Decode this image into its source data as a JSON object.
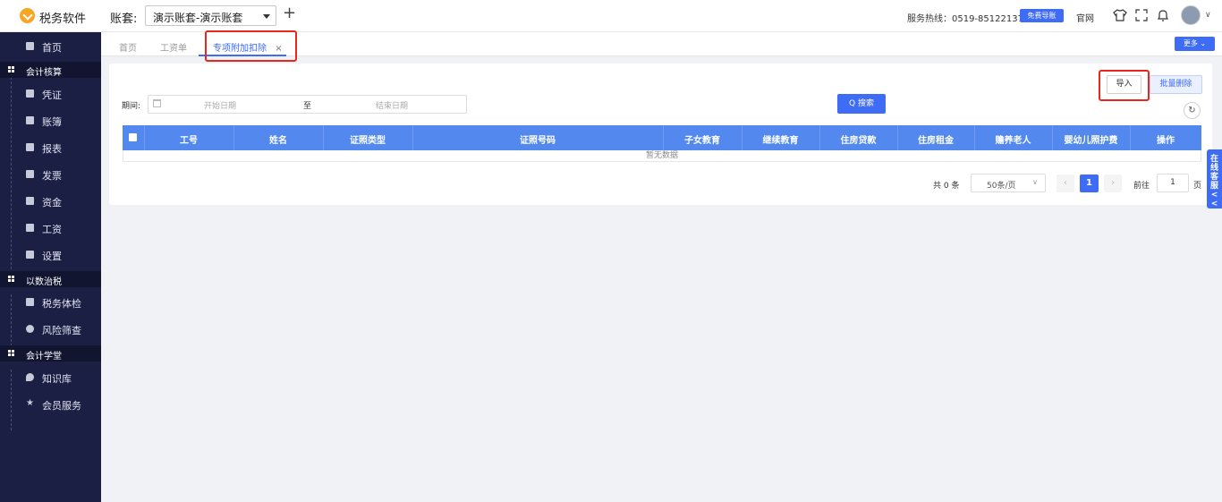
{
  "header": {
    "app_name": "税务软件",
    "account_label": "账套:",
    "account_value": "演示账套-演示账套",
    "hotline": "服务热线：0519-85122137",
    "guide_button": "免费导账",
    "site_link": "官网"
  },
  "sidebar": {
    "items": [
      {
        "label": "首页"
      },
      {
        "label": "凭证"
      },
      {
        "label": "账簿"
      },
      {
        "label": "报表"
      },
      {
        "label": "发票"
      },
      {
        "label": "资金"
      },
      {
        "label": "工资"
      },
      {
        "label": "设置"
      },
      {
        "label": "税务体检"
      },
      {
        "label": "风险筛查"
      },
      {
        "label": "知识库"
      },
      {
        "label": "会员服务"
      }
    ],
    "groups": [
      {
        "label": "会计核算"
      },
      {
        "label": "以数治税"
      },
      {
        "label": "会计学堂"
      }
    ]
  },
  "tabs": {
    "items": [
      {
        "label": "首页"
      },
      {
        "label": "工资单"
      },
      {
        "label": "专项附加扣除"
      }
    ],
    "close_glyph": "×",
    "more_button": "更多 ⌄"
  },
  "toolbar": {
    "import_button": "导入",
    "batch_delete_button": "批量删除",
    "refresh_glyph": "↻"
  },
  "filter": {
    "period_label": "期间:",
    "start_placeholder": "开始日期",
    "to_label": "至",
    "end_placeholder": "结束日期",
    "search_button": "Q 搜索"
  },
  "table": {
    "columns": [
      "工号",
      "姓名",
      "证照类型",
      "证照号码",
      "子女教育",
      "继续教育",
      "住房贷款",
      "住房租金",
      "赡养老人",
      "婴幼儿照护费",
      "操作"
    ],
    "empty_text": "暂无数据"
  },
  "pagination": {
    "total": "共 0 条",
    "page_size": "50条/页",
    "prev": "‹",
    "current_page": "1",
    "next": "›",
    "goto_label": "前往",
    "goto_value": "1",
    "unit": "页"
  },
  "customer_service": {
    "label": "在线客服<<"
  }
}
